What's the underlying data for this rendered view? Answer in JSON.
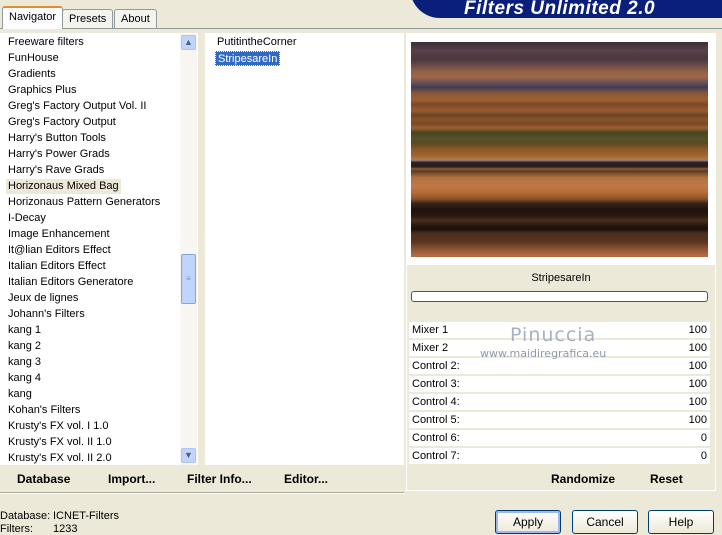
{
  "app": {
    "banner": "Filters Unlimited 2.0"
  },
  "tabs": [
    {
      "label": "Navigator",
      "active": true
    },
    {
      "label": "Presets"
    },
    {
      "label": "About"
    }
  ],
  "categories": {
    "selected": "Horizonaus Mixed Bag",
    "items": [
      "Freeware filters",
      "FunHouse",
      "Gradients",
      "Graphics Plus",
      "Greg's Factory Output Vol. II",
      "Greg's Factory Output",
      "Harry's Button Tools",
      "Harry's Power Grads",
      "Harry's Rave Grads",
      "Horizonaus Mixed Bag",
      "Horizonaus Pattern Generators",
      "I-Decay",
      "Image Enhancement",
      "It@lian Editors Effect",
      "Italian Editors Effect",
      "Italian Editors Generatore",
      "Jeux de lignes",
      "Johann's Filters",
      "kang 1",
      "kang 2",
      "kang 3",
      "kang 4",
      "kang",
      "Kohan's Filters",
      "Krusty's FX vol. I 1.0",
      "Krusty's FX vol. II 1.0",
      "Krusty's FX vol. II 2.0"
    ]
  },
  "filters": {
    "selected": "StripesareIn",
    "items": [
      "PutitintheCorner",
      "StripesareIn"
    ]
  },
  "params": {
    "filter_name": "StripesareIn",
    "rows": [
      {
        "label": "Mixer 1",
        "value": "100"
      },
      {
        "label": "Mixer 2",
        "value": "100"
      },
      {
        "label": "Control 2:",
        "value": "100"
      },
      {
        "label": "Control 3:",
        "value": "100"
      },
      {
        "label": "Control 4:",
        "value": "100"
      },
      {
        "label": "Control 5:",
        "value": "100"
      },
      {
        "label": "Control 6:",
        "value": "0"
      },
      {
        "label": "Control 7:",
        "value": "0"
      }
    ],
    "randomize": "Randomize",
    "reset": "Reset"
  },
  "watermark": {
    "name": "Pinuccia",
    "url": "www.maidiregrafica.eu"
  },
  "toolbar": {
    "database": "Database",
    "import": "Import...",
    "filter_info": "Filter Info...",
    "editor": "Editor..."
  },
  "status": {
    "database_label": "Database:",
    "database_value": "ICNET-Filters",
    "filters_label": "Filters:",
    "filters_value": "1233"
  },
  "buttons": {
    "apply": "Apply",
    "cancel": "Cancel",
    "help": "Help"
  },
  "colors": {
    "selection": "#316ac5",
    "banner": "#0a1f7a",
    "face": "#ece9d8"
  }
}
